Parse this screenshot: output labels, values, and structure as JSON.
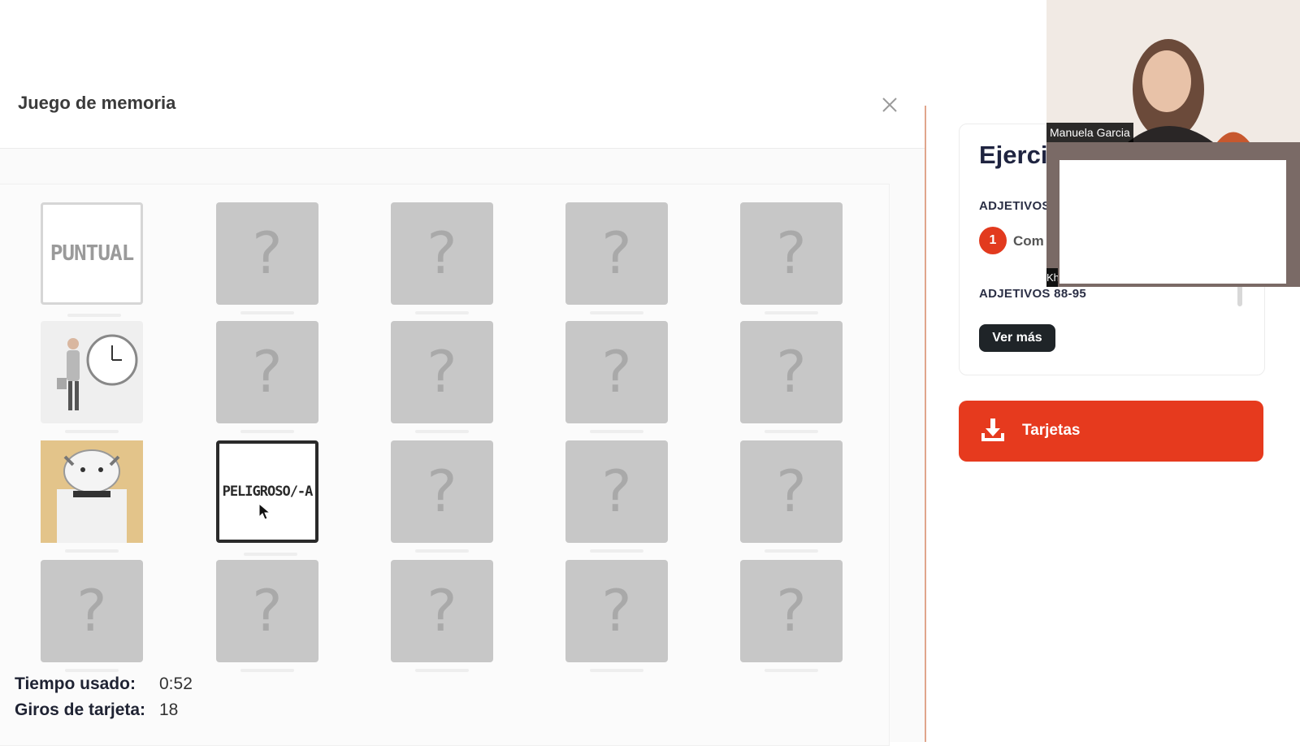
{
  "modal": {
    "title": "Juego de memoria",
    "close_icon": "close-icon"
  },
  "board": {
    "hidden_symbol": "?",
    "rows": [
      [
        {
          "state": "word",
          "text": "PUNTUAL"
        },
        {
          "state": "hidden"
        },
        {
          "state": "hidden"
        },
        {
          "state": "hidden"
        },
        {
          "state": "hidden"
        }
      ],
      [
        {
          "state": "image",
          "icon": "person-clock-illustration"
        },
        {
          "state": "hidden"
        },
        {
          "state": "hidden"
        },
        {
          "state": "hidden"
        },
        {
          "state": "hidden"
        }
      ],
      [
        {
          "state": "image",
          "icon": "angry-bulldog-illustration"
        },
        {
          "state": "word",
          "text": "PELIGROSO/-A"
        },
        {
          "state": "hidden"
        },
        {
          "state": "hidden"
        },
        {
          "state": "hidden"
        }
      ],
      [
        {
          "state": "hidden"
        },
        {
          "state": "hidden"
        },
        {
          "state": "hidden"
        },
        {
          "state": "hidden"
        },
        {
          "state": "hidden"
        }
      ]
    ]
  },
  "stats": {
    "time_label": "Tiempo usado:",
    "time_value": "0:52",
    "flips_label": "Giros de tarjeta:",
    "flips_value": "18"
  },
  "exercise": {
    "title": "Ejerci",
    "section1": "ADJETIVOS",
    "step_number": "1",
    "step_label": "Com",
    "section2": "ADJETIVOS 88-95",
    "more_button": "Ver más"
  },
  "download": {
    "label": "Tarjetas",
    "icon": "download-icon"
  },
  "video": {
    "participant1": "Manuela Garcia",
    "participant2_fragment": "Kh"
  },
  "colors": {
    "accent": "#e63a1e",
    "card_hidden": "#c7c7c7",
    "dark_button": "#1f2428"
  }
}
